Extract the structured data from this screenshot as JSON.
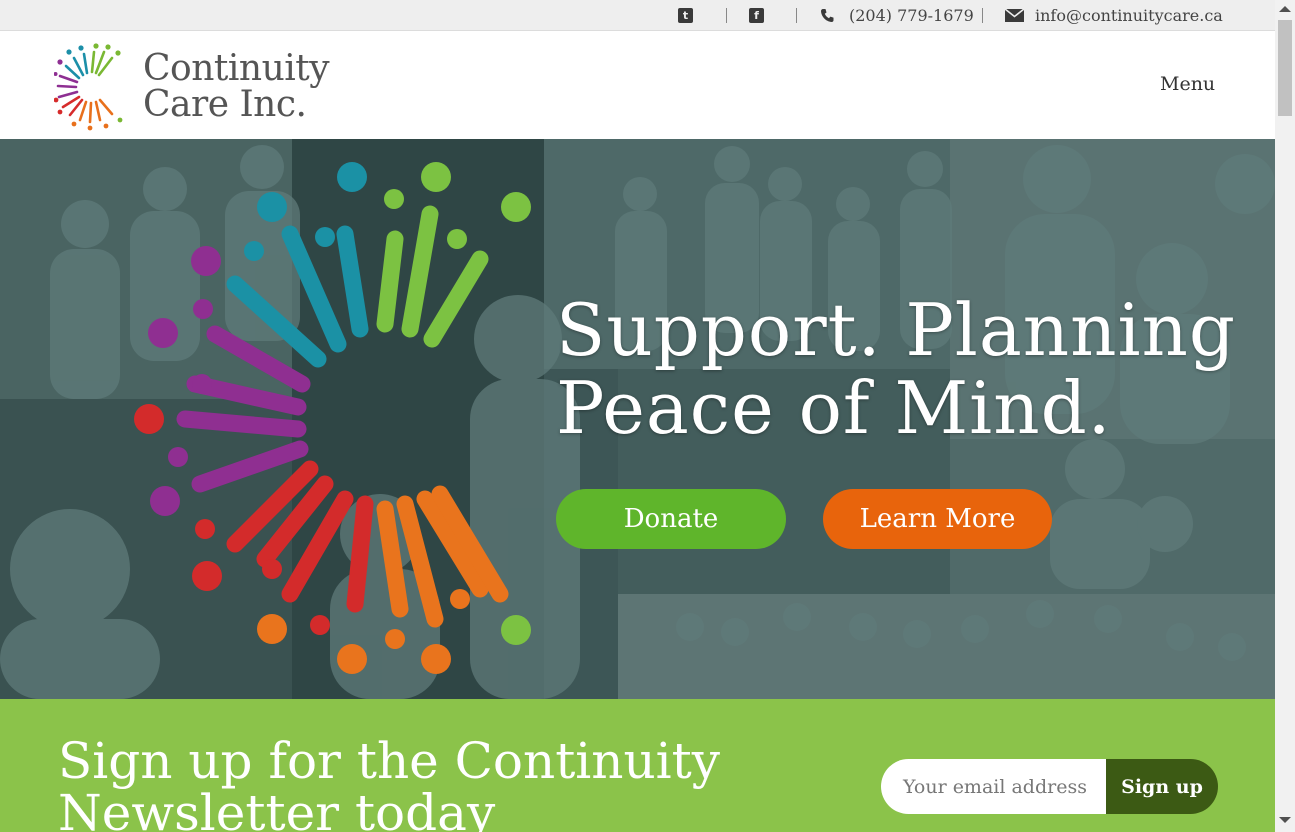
{
  "topbar": {
    "twitter_icon": "twitter-icon",
    "facebook_icon": "facebook-icon",
    "phone": "(204) 779-1679",
    "email": "info@continuitycare.ca"
  },
  "header": {
    "brand_line1": "Continuity",
    "brand_line2": "Care Inc.",
    "menu_label": "Menu"
  },
  "hero": {
    "headline_line1": "Support. Planning",
    "headline_line2": "Peace of Mind.",
    "donate_label": "Donate",
    "learn_more_label": "Learn More"
  },
  "newsletter": {
    "title_line1": "Sign up for the Continuity",
    "title_line2": "Newsletter today",
    "email_placeholder": "Your email address",
    "signup_label": "Sign up"
  },
  "colors": {
    "green": "#5fb52b",
    "orange": "#e8640c",
    "light_green": "#8bc34a",
    "dark_green": "#3c5a14",
    "teal": "#3d5656"
  }
}
